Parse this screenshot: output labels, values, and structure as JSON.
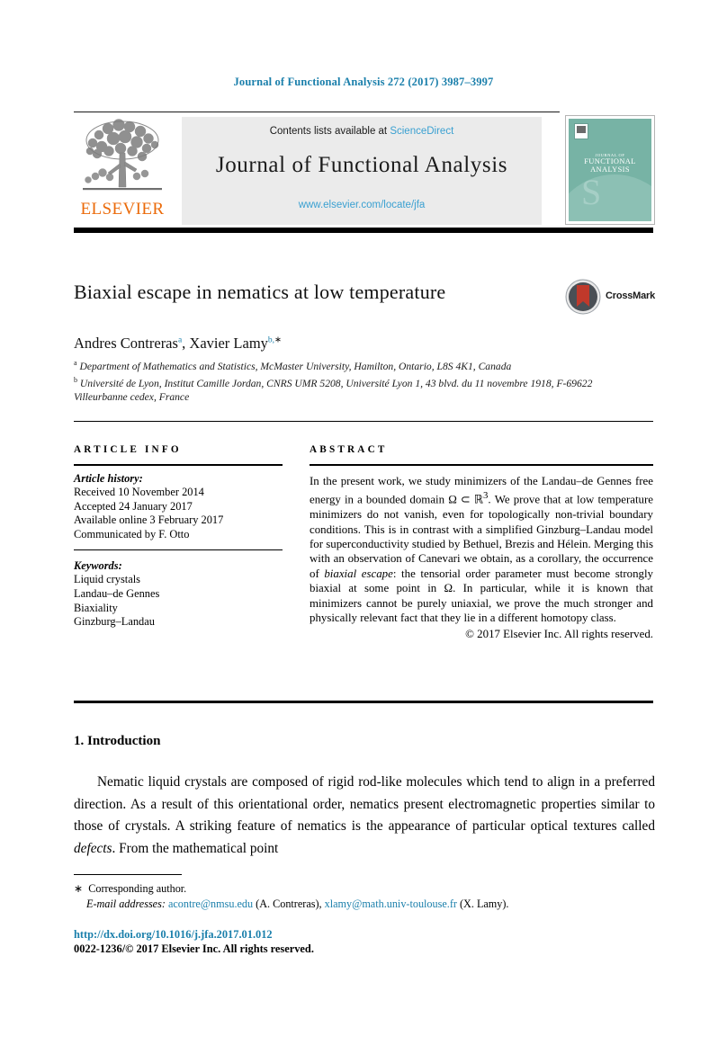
{
  "running_head": "Journal of Functional Analysis 272 (2017) 3987–3997",
  "masthead": {
    "contents_prefix": "Contents lists available at ",
    "sciencedirect": "ScienceDirect",
    "journal_title": "Journal of Functional Analysis",
    "journal_url": "www.elsevier.com/locate/jfa",
    "publisher_wordmark": "ELSEVIER",
    "cover": {
      "line1": "JOURNAL OF",
      "line2": "FUNCTIONAL",
      "line3": "ANALYSIS"
    }
  },
  "article": {
    "title": "Biaxial escape in nematics at low temperature",
    "crossmark_label": "CrossMark",
    "authors_html": "Andres Contreras<sup>a</sup>, Xavier Lamy<sup>b,</sup><sup class=\"plain\">∗</sup>",
    "affiliations_html": "<sup>a</sup> Department of Mathematics and Statistics, McMaster University, Hamilton, Ontario, L8S 4K1, Canada<br><sup>b</sup> Université de Lyon, Institut Camille Jordan, CNRS UMR 5208, Université Lyon 1, 43 blvd. du 11 novembre 1918, F-69622 Villeurbanne cedex, France"
  },
  "info": {
    "heading": "ARTICLE INFO",
    "history_title": "Article history:",
    "history": [
      "Received 10 November 2014",
      "Accepted 24 January 2017",
      "Available online 3 February 2017",
      "Communicated by F. Otto"
    ],
    "keywords_title": "Keywords:",
    "keywords": [
      "Liquid crystals",
      "Landau–de Gennes",
      "Biaxiality",
      "Ginzburg–Landau"
    ]
  },
  "abstract": {
    "heading": "ABSTRACT",
    "text_html": "In the present work, we study minimizers of the Landau–de Gennes free energy in a bounded domain Ω ⊂ ℝ<sup>3</sup>. We prove that at low temperature minimizers do not vanish, even for topologically non-trivial boundary conditions. This is in contrast with a simplified Ginzburg–Landau model for superconductivity studied by Bethuel, Brezis and Hélein. Merging this with an observation of Canevari we obtain, as a corollary, the occurrence of <i>biaxial escape</i>: the tensorial order parameter must become strongly biaxial at some point in Ω. In particular, while it is known that minimizers cannot be purely uniaxial, we prove the much stronger and physically relevant fact that they lie in a different homotopy class.",
    "copyright": "© 2017 Elsevier Inc. All rights reserved."
  },
  "body": {
    "section_heading": "1. Introduction",
    "paragraph_html": "Nematic liquid crystals are composed of rigid rod-like molecules which tend to align in a preferred direction. As a result of this orientational order, nematics present electromagnetic properties similar to those of crystals. A striking feature of nematics is the appearance of particular optical textures called <i>defects</i>. From the mathematical point"
  },
  "footnotes": {
    "corresponding_star": "∗",
    "corresponding_text": "Corresponding author.",
    "email_label": "E-mail addresses:",
    "email1": "acontre@nmsu.edu",
    "email1_owner": "(A. Contreras),",
    "email2": "xlamy@math.univ-toulouse.fr",
    "email2_owner": "(X. Lamy).",
    "doi": "http://dx.doi.org/10.1016/j.jfa.2017.01.012",
    "issn": "0022-1236/© 2017 Elsevier Inc. All rights reserved."
  },
  "colors": {
    "link_blue": "#1a7fab",
    "sciencedirect_blue": "#3aa0d1",
    "elsevier_orange": "#eb6a09",
    "cover_teal": "#77b3a5",
    "crossmark_red": "#c0392b"
  }
}
